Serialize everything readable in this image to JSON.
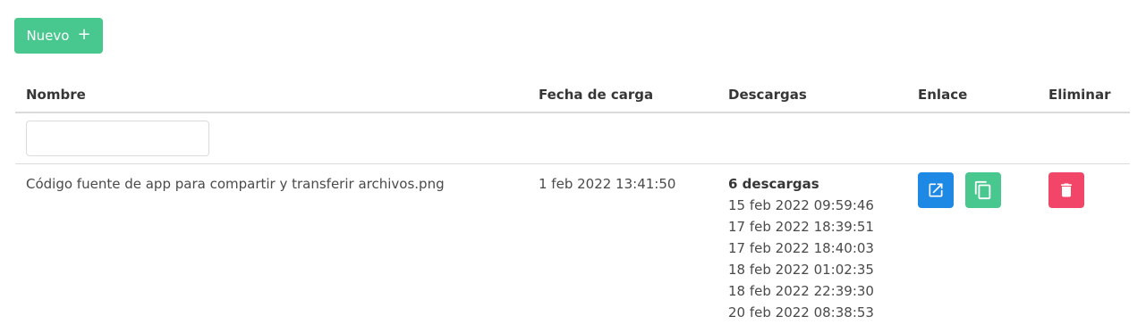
{
  "toolbar": {
    "new_label": "Nuevo",
    "new_icon": "plus-icon"
  },
  "table": {
    "headers": {
      "name": "Nombre",
      "upload_date": "Fecha de carga",
      "downloads": "Descargas",
      "link": "Enlace",
      "delete": "Eliminar"
    },
    "filter": {
      "name_value": "",
      "name_placeholder": ""
    },
    "rows": [
      {
        "name": "Código fuente de app para compartir y transferir archivos.png",
        "upload_date": "1 feb 2022 13:41:50",
        "downloads_summary": "6 descargas",
        "downloads_list": [
          "15 feb 2022 09:59:46",
          "17 feb 2022 18:39:51",
          "17 feb 2022 18:40:03",
          "18 feb 2022 01:02:35",
          "18 feb 2022 22:39:30",
          "20 feb 2022 08:38:53"
        ],
        "link_actions": [
          "open-external-icon",
          "copy-icon"
        ],
        "delete_action": "trash-icon"
      }
    ]
  },
  "colors": {
    "success": "#48c78e",
    "link": "#1e88e5",
    "danger": "#f14668",
    "border": "#dbdbdb"
  }
}
